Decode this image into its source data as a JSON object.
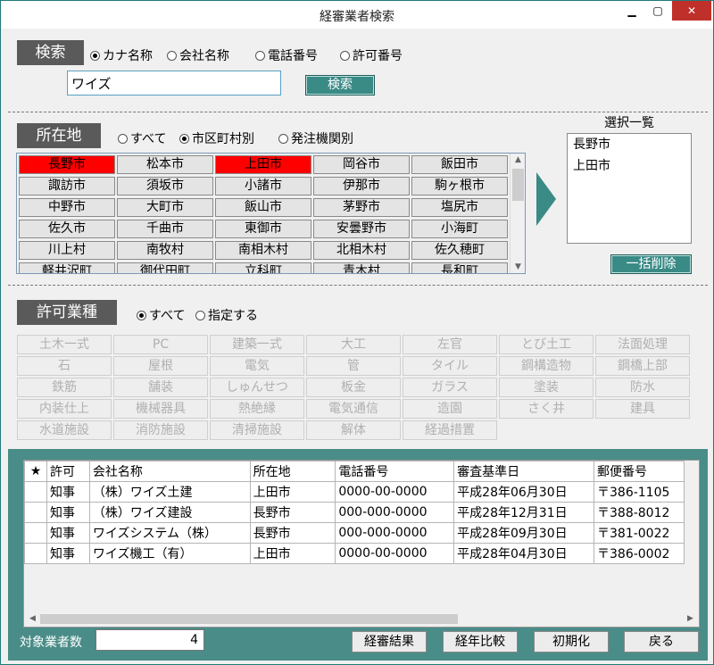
{
  "window": {
    "title": "経審業者検索",
    "min": "▁",
    "max": "▢",
    "close": "✕"
  },
  "search": {
    "header": "検索",
    "modes": [
      {
        "label": "カナ名称",
        "selected": true
      },
      {
        "label": "会社名称",
        "selected": false
      },
      {
        "label": "電話番号",
        "selected": false
      },
      {
        "label": "許可番号",
        "selected": false
      }
    ],
    "input_value": "ワイズ",
    "button": "検索"
  },
  "location": {
    "header": "所在地",
    "modes": [
      {
        "label": "すべて",
        "selected": false
      },
      {
        "label": "市区町村別",
        "selected": true
      },
      {
        "label": "発注機関別",
        "selected": false
      }
    ],
    "cities": [
      {
        "name": "長野市",
        "selected": true
      },
      {
        "name": "松本市",
        "selected": false
      },
      {
        "name": "上田市",
        "selected": true
      },
      {
        "name": "岡谷市",
        "selected": false
      },
      {
        "name": "飯田市",
        "selected": false
      },
      {
        "name": "諏訪市",
        "selected": false
      },
      {
        "name": "須坂市",
        "selected": false
      },
      {
        "name": "小諸市",
        "selected": false
      },
      {
        "name": "伊那市",
        "selected": false
      },
      {
        "name": "駒ヶ根市",
        "selected": false
      },
      {
        "name": "中野市",
        "selected": false
      },
      {
        "name": "大町市",
        "selected": false
      },
      {
        "name": "飯山市",
        "selected": false
      },
      {
        "name": "茅野市",
        "selected": false
      },
      {
        "name": "塩尻市",
        "selected": false
      },
      {
        "name": "佐久市",
        "selected": false
      },
      {
        "name": "千曲市",
        "selected": false
      },
      {
        "name": "東御市",
        "selected": false
      },
      {
        "name": "安曇野市",
        "selected": false
      },
      {
        "name": "小海町",
        "selected": false
      },
      {
        "name": "川上村",
        "selected": false
      },
      {
        "name": "南牧村",
        "selected": false
      },
      {
        "name": "南相木村",
        "selected": false
      },
      {
        "name": "北相木村",
        "selected": false
      },
      {
        "name": "佐久穂町",
        "selected": false
      },
      {
        "name": "軽井沢町",
        "selected": false
      },
      {
        "name": "御代田町",
        "selected": false
      },
      {
        "name": "立科町",
        "selected": false
      },
      {
        "name": "青木村",
        "selected": false
      },
      {
        "name": "長和町",
        "selected": false
      }
    ],
    "selection_title": "選択一覧",
    "selection": [
      "長野市",
      "上田市"
    ],
    "clear_button": "一括削除"
  },
  "license": {
    "header": "許可業種",
    "modes": [
      {
        "label": "すべて",
        "selected": true
      },
      {
        "label": "指定する",
        "selected": false
      }
    ],
    "types": [
      "土木一式",
      "PC",
      "建築一式",
      "大工",
      "左官",
      "とび土工",
      "法面処理",
      "石",
      "屋根",
      "電気",
      "管",
      "タイル",
      "鋼構造物",
      "鋼橋上部",
      "鉄筋",
      "舗装",
      "しゅんせつ",
      "板金",
      "ガラス",
      "塗装",
      "防水",
      "内装仕上",
      "機械器具",
      "熱絶縁",
      "電気通信",
      "造園",
      "さく井",
      "建具",
      "水道施設",
      "消防施設",
      "清掃施設",
      "解体",
      "経過措置"
    ]
  },
  "results": {
    "columns": [
      "★",
      "許可",
      "会社名称",
      "所在地",
      "電話番号",
      "審査基準日",
      "郵便番号"
    ],
    "rows": [
      [
        "",
        "知事",
        "（株）ワイズ土建",
        "上田市",
        "0000-00-0000",
        "平成28年06月30日",
        "〒386-1105"
      ],
      [
        "",
        "知事",
        "（株）ワイズ建設",
        "長野市",
        "000-000-0000",
        "平成28年12月31日",
        "〒388-8012"
      ],
      [
        "",
        "知事",
        "ワイズシステム（株）",
        "長野市",
        "000-000-0000",
        "平成28年09月30日",
        "〒381-0022"
      ],
      [
        "",
        "知事",
        "ワイズ機工（有）",
        "上田市",
        "0000-00-0000",
        "平成28年04月30日",
        "〒386-0002"
      ]
    ],
    "count_label": "対象業者数",
    "count": "4"
  },
  "buttons": {
    "result": "経審結果",
    "compare": "経年比較",
    "reset": "初期化",
    "back": "戻る"
  },
  "colors": {
    "accent": "#3a8a86",
    "selected_city": "#ff0000",
    "header_bg": "#5a5a5a",
    "close": "#c0302a"
  }
}
